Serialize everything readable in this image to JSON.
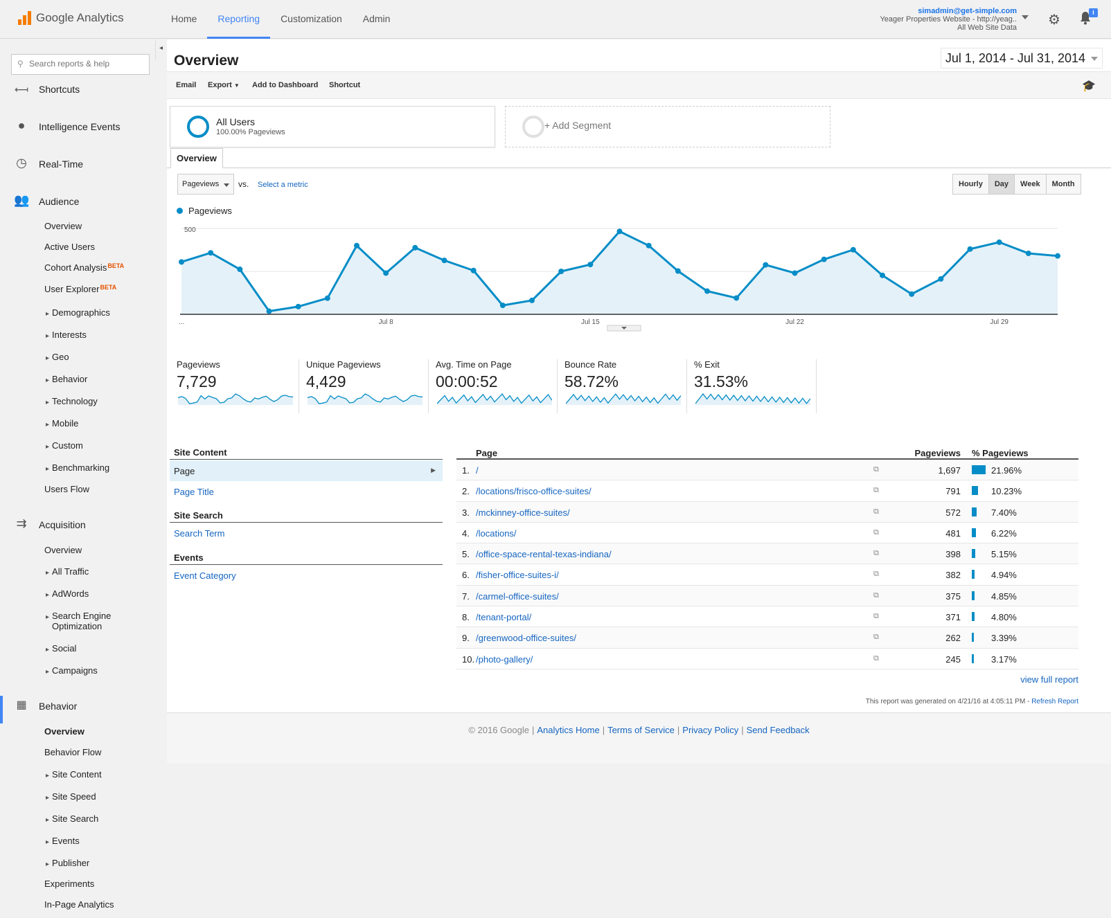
{
  "app": {
    "name": "Google Analytics"
  },
  "topnav": [
    "Home",
    "Reporting",
    "Customization",
    "Admin"
  ],
  "account": {
    "email": "simadmin@get-simple.com",
    "property": "Yeager Properties Website - http://yeag..",
    "view": "All Web Site Data"
  },
  "notifications_badge": "i",
  "sidebar": {
    "search_placeholder": "Search reports & help",
    "sections": {
      "shortcuts": "Shortcuts",
      "intelligence": "Intelligence Events",
      "realtime": "Real-Time",
      "audience": "Audience",
      "acquisition": "Acquisition",
      "behavior": "Behavior"
    },
    "audience_items": [
      "Overview",
      "Active Users",
      "Cohort Analysis",
      "User Explorer",
      "Demographics",
      "Interests",
      "Geo",
      "Behavior",
      "Technology",
      "Mobile",
      "Custom",
      "Benchmarking",
      "Users Flow"
    ],
    "beta_label": "BETA",
    "acquisition_items": [
      "Overview",
      "All Traffic",
      "AdWords",
      "Search Engine",
      "Optimization",
      "Social",
      "Campaigns"
    ],
    "behavior_items": [
      "Overview",
      "Behavior Flow",
      "Site Content",
      "Site Speed",
      "Site Search",
      "Events",
      "Publisher",
      "Experiments",
      "In-Page Analytics"
    ]
  },
  "page": {
    "title": "Overview",
    "date_range": "Jul 1, 2014 - Jul 31, 2014",
    "toolbar": [
      "Email",
      "Export",
      "Add to Dashboard",
      "Shortcut"
    ],
    "segment": {
      "name": "All Users",
      "sub": "100.00% Pageviews",
      "add": "+ Add Segment"
    },
    "tab": "Overview",
    "metric_select": "Pageviews",
    "vs": "vs.",
    "select_metric": "Select a metric",
    "granularity": [
      "Hourly",
      "Day",
      "Week",
      "Month"
    ],
    "granularity_selected": "Day"
  },
  "chart_data": {
    "type": "area",
    "series": [
      {
        "name": "Pageviews",
        "values": [
          305,
          358,
          262,
          18,
          45,
          94,
          400,
          240,
          388,
          314,
          255,
          52,
          81,
          250,
          290,
          483,
          400,
          252,
          135,
          95,
          288,
          240,
          320,
          376,
          227,
          118,
          206,
          380,
          420,
          355,
          340
        ]
      }
    ],
    "x": [
      "Jul 1",
      "Jul 2",
      "Jul 3",
      "Jul 4",
      "Jul 5",
      "Jul 6",
      "Jul 7",
      "Jul 8",
      "Jul 9",
      "Jul 10",
      "Jul 11",
      "Jul 12",
      "Jul 13",
      "Jul 14",
      "Jul 15",
      "Jul 16",
      "Jul 17",
      "Jul 18",
      "Jul 19",
      "Jul 20",
      "Jul 21",
      "Jul 22",
      "Jul 23",
      "Jul 24",
      "Jul 25",
      "Jul 26",
      "Jul 27",
      "Jul 28",
      "Jul 29",
      "Jul 30",
      "Jul 31"
    ],
    "x_tick_labels": [
      "...",
      "Jul 8",
      "Jul 15",
      "Jul 22",
      "Jul 29"
    ],
    "y_ticks": [
      "500",
      "250"
    ],
    "ylim": [
      0,
      500
    ],
    "color": "#058dc7"
  },
  "kpis": [
    {
      "label": "Pageviews",
      "value": "7,729"
    },
    {
      "label": "Unique Pageviews",
      "value": "4,429"
    },
    {
      "label": "Avg. Time on Page",
      "value": "00:00:52"
    },
    {
      "label": "Bounce Rate",
      "value": "58.72%"
    },
    {
      "label": "% Exit",
      "value": "31.53%"
    }
  ],
  "site_content": {
    "heading": "Site Content",
    "page": "Page",
    "page_title": "Page Title",
    "search_heading": "Site Search",
    "search_term": "Search Term",
    "events_heading": "Events",
    "event_category": "Event Category"
  },
  "table": {
    "headers": [
      "Page",
      "Pageviews",
      "% Pageviews"
    ],
    "rows": [
      {
        "n": "1.",
        "page": "/",
        "pv": "1,697",
        "pct": "21.96%",
        "share": 0.2196
      },
      {
        "n": "2.",
        "page": "/locations/frisco-office-suites/",
        "pv": "791",
        "pct": "10.23%",
        "share": 0.1023
      },
      {
        "n": "3.",
        "page": "/mckinney-office-suites/",
        "pv": "572",
        "pct": "7.40%",
        "share": 0.074
      },
      {
        "n": "4.",
        "page": "/locations/",
        "pv": "481",
        "pct": "6.22%",
        "share": 0.0622
      },
      {
        "n": "5.",
        "page": "/office-space-rental-texas-indiana/",
        "pv": "398",
        "pct": "5.15%",
        "share": 0.0515
      },
      {
        "n": "6.",
        "page": "/fisher-office-suites-i/",
        "pv": "382",
        "pct": "4.94%",
        "share": 0.0494
      },
      {
        "n": "7.",
        "page": "/carmel-office-suites/",
        "pv": "375",
        "pct": "4.85%",
        "share": 0.0485
      },
      {
        "n": "8.",
        "page": "/tenant-portal/",
        "pv": "371",
        "pct": "4.80%",
        "share": 0.048
      },
      {
        "n": "9.",
        "page": "/greenwood-office-suites/",
        "pv": "262",
        "pct": "3.39%",
        "share": 0.0339
      },
      {
        "n": "10.",
        "page": "/photo-gallery/",
        "pv": "245",
        "pct": "3.17%",
        "share": 0.0317
      }
    ],
    "view_full": "view full report",
    "generated": "This report was generated on 4/21/16 at 4:05:11 PM - ",
    "refresh": "Refresh Report"
  },
  "footer": {
    "copyright": "© 2016 Google",
    "links": [
      "Analytics Home",
      "Terms of Service",
      "Privacy Policy",
      "Send Feedback"
    ]
  }
}
